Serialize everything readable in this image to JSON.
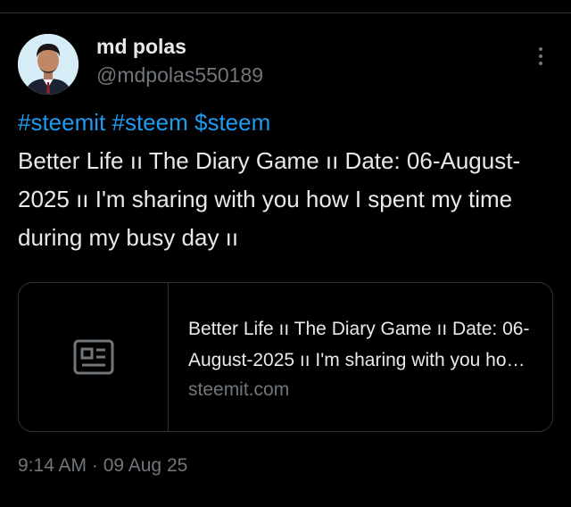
{
  "author": {
    "display_name": "md polas",
    "handle": "@mdpolas550189",
    "avatar_icon": "profile-photo"
  },
  "tweet": {
    "hashtags": [
      "#steemit",
      "#steem",
      "$steem"
    ],
    "body": "Better Life ıı The Diary Game ıı Date: 06-August-2025 ıı I'm sharing with you how I spent my time during my busy day ıı"
  },
  "link_card": {
    "icon": "article-icon",
    "title": "Better Life ıı The Diary Game ıı Date: 06-August-2025 ıı I'm sharing with you how I spent my time during my busy day ıı",
    "domain": "steemit.com"
  },
  "timestamp": "9:14 AM · 09 Aug 25",
  "more_icon": "more-vertical-icon",
  "colors": {
    "background": "#000000",
    "text": "#e7e9ea",
    "secondary": "#71767b",
    "accent": "#1d9bf0",
    "border": "#2f3336"
  }
}
